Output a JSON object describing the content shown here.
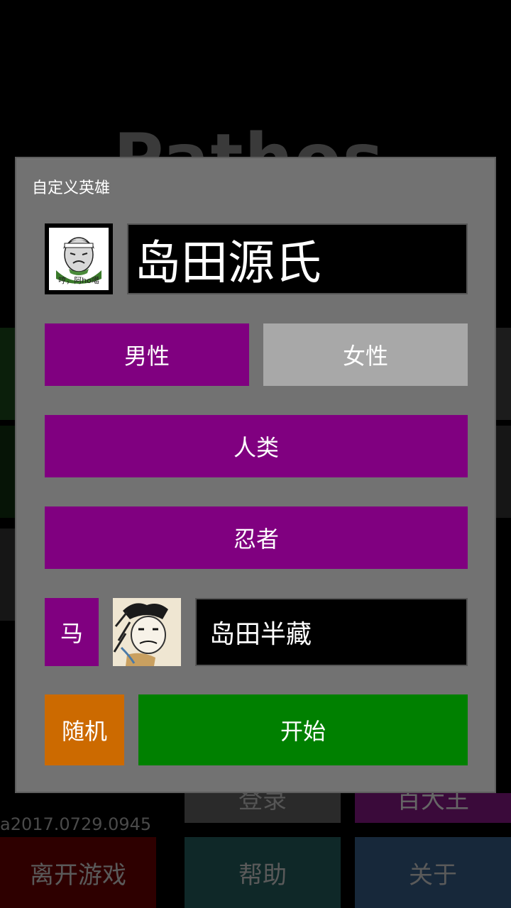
{
  "background": {
    "app_title": "Pathos",
    "version": "a2017.0729.0945",
    "tiles": {
      "login": "登录",
      "other": "百大王",
      "exit": "离开游戏",
      "help": "帮助",
      "about": "关于"
    }
  },
  "dialog": {
    "title": "自定义英雄",
    "hero_name": "岛田源氏",
    "avatar_caption": "哼，阿ho噶",
    "gender": {
      "male_label": "男性",
      "female_label": "女性",
      "selected": "男性"
    },
    "race_label": "人类",
    "class_label": "忍者",
    "mount": {
      "label": "马",
      "name": "岛田半藏"
    },
    "random_label": "随机",
    "start_label": "开始"
  },
  "colors": {
    "purple": "#800080",
    "gray_unselected": "#a8a8a8",
    "orange": "#cc6a00",
    "green": "#008000",
    "dialog_bg": "#727272"
  },
  "icons": {
    "hero_avatar": "meme-face-avatar",
    "mount_avatar": "sketch-face-avatar"
  }
}
